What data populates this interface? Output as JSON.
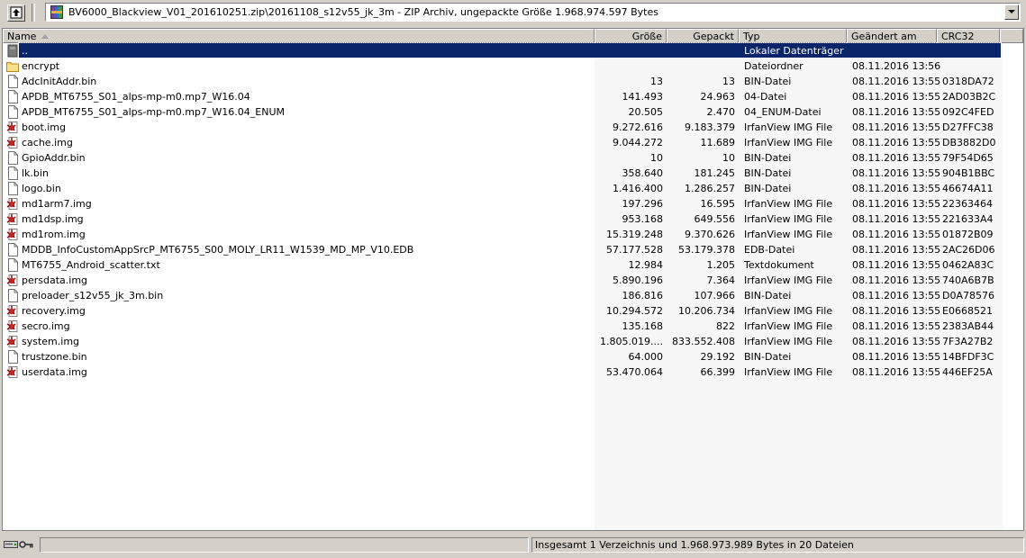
{
  "toolbar": {
    "path": "BV6000_Blackview_V01_201610251.zip\\20161108_s12v55_jk_3m - ZIP Archiv, ungepackte Größe 1.968.974.597 Bytes"
  },
  "columns": {
    "name": "Name",
    "size": "Größe",
    "packed": "Gepackt",
    "type": "Typ",
    "modified": "Geändert am",
    "crc": "CRC32"
  },
  "rows": [
    {
      "name": "..",
      "size": "",
      "packed": "",
      "type": "Lokaler Datenträger",
      "modified": "",
      "crc": "",
      "icon": "parent-folder-icon"
    },
    {
      "name": "encrypt",
      "size": "",
      "packed": "",
      "type": "Dateiordner",
      "modified": "08.11.2016 13:56",
      "crc": "",
      "icon": "folder-icon"
    },
    {
      "name": "AdcInitAddr.bin",
      "size": "13",
      "packed": "13",
      "type": "BIN-Datei",
      "modified": "08.11.2016 13:55",
      "crc": "0318DA72",
      "icon": "file-icon"
    },
    {
      "name": "APDB_MT6755_S01_alps-mp-m0.mp7_W16.04",
      "size": "141.493",
      "packed": "24.963",
      "type": "04-Datei",
      "modified": "08.11.2016 13:55",
      "crc": "2AD03B2C",
      "icon": "file-icon"
    },
    {
      "name": "APDB_MT6755_S01_alps-mp-m0.mp7_W16.04_ENUM",
      "size": "20.505",
      "packed": "2.470",
      "type": "04_ENUM-Datei",
      "modified": "08.11.2016 13:55",
      "crc": "092C4FED",
      "icon": "file-icon"
    },
    {
      "name": "boot.img",
      "size": "9.272.616",
      "packed": "9.183.379",
      "type": "IrfanView IMG File",
      "modified": "08.11.2016 13:55",
      "crc": "D27FFC38",
      "icon": "irfanview-icon"
    },
    {
      "name": "cache.img",
      "size": "9.044.272",
      "packed": "11.689",
      "type": "IrfanView IMG File",
      "modified": "08.11.2016 13:55",
      "crc": "DB3882D0",
      "icon": "irfanview-icon"
    },
    {
      "name": "GpioAddr.bin",
      "size": "10",
      "packed": "10",
      "type": "BIN-Datei",
      "modified": "08.11.2016 13:55",
      "crc": "79F54D65",
      "icon": "file-icon"
    },
    {
      "name": "lk.bin",
      "size": "358.640",
      "packed": "181.245",
      "type": "BIN-Datei",
      "modified": "08.11.2016 13:55",
      "crc": "904B1BBC",
      "icon": "file-icon"
    },
    {
      "name": "logo.bin",
      "size": "1.416.400",
      "packed": "1.286.257",
      "type": "BIN-Datei",
      "modified": "08.11.2016 13:55",
      "crc": "46674A11",
      "icon": "file-icon"
    },
    {
      "name": "md1arm7.img",
      "size": "197.296",
      "packed": "16.595",
      "type": "IrfanView IMG File",
      "modified": "08.11.2016 13:55",
      "crc": "22363464",
      "icon": "irfanview-icon"
    },
    {
      "name": "md1dsp.img",
      "size": "953.168",
      "packed": "649.556",
      "type": "IrfanView IMG File",
      "modified": "08.11.2016 13:55",
      "crc": "221633A4",
      "icon": "irfanview-icon"
    },
    {
      "name": "md1rom.img",
      "size": "15.319.248",
      "packed": "9.370.626",
      "type": "IrfanView IMG File",
      "modified": "08.11.2016 13:55",
      "crc": "01872B09",
      "icon": "irfanview-icon"
    },
    {
      "name": "MDDB_InfoCustomAppSrcP_MT6755_S00_MOLY_LR11_W1539_MD_MP_V10.EDB",
      "size": "57.177.528",
      "packed": "53.179.378",
      "type": "EDB-Datei",
      "modified": "08.11.2016 13:55",
      "crc": "2AC26D06",
      "icon": "file-icon"
    },
    {
      "name": "MT6755_Android_scatter.txt",
      "size": "12.984",
      "packed": "1.205",
      "type": "Textdokument",
      "modified": "08.11.2016 13:55",
      "crc": "0462A83C",
      "icon": "file-icon"
    },
    {
      "name": "persdata.img",
      "size": "5.890.196",
      "packed": "7.364",
      "type": "IrfanView IMG File",
      "modified": "08.11.2016 13:55",
      "crc": "740A6B7B",
      "icon": "irfanview-icon"
    },
    {
      "name": "preloader_s12v55_jk_3m.bin",
      "size": "186.816",
      "packed": "107.966",
      "type": "BIN-Datei",
      "modified": "08.11.2016 13:55",
      "crc": "D0A78576",
      "icon": "file-icon"
    },
    {
      "name": "recovery.img",
      "size": "10.294.572",
      "packed": "10.206.734",
      "type": "IrfanView IMG File",
      "modified": "08.11.2016 13:55",
      "crc": "E0668521",
      "icon": "irfanview-icon"
    },
    {
      "name": "secro.img",
      "size": "135.168",
      "packed": "822",
      "type": "IrfanView IMG File",
      "modified": "08.11.2016 13:55",
      "crc": "2383AB44",
      "icon": "irfanview-icon"
    },
    {
      "name": "system.img",
      "size": "1.805.019....",
      "packed": "833.552.408",
      "type": "IrfanView IMG File",
      "modified": "08.11.2016 13:55",
      "crc": "7F3A27B2",
      "icon": "irfanview-icon"
    },
    {
      "name": "trustzone.bin",
      "size": "64.000",
      "packed": "29.192",
      "type": "BIN-Datei",
      "modified": "08.11.2016 13:55",
      "crc": "14BFDF3C",
      "icon": "file-icon"
    },
    {
      "name": "userdata.img",
      "size": "53.470.064",
      "packed": "66.399",
      "type": "IrfanView IMG File",
      "modified": "08.11.2016 13:55",
      "crc": "446EF25A",
      "icon": "irfanview-icon"
    }
  ],
  "selected_index": 0,
  "statusbar": {
    "left_icons": [
      "drive-icon",
      "key-icon"
    ],
    "summary": "Insgesamt 1 Verzeichnis und 1.968.973.989 Bytes in 20 Dateien"
  },
  "colors": {
    "selection": "#0a246a",
    "window": "#d4d0c8",
    "irfanview_red": "#c0282a"
  }
}
